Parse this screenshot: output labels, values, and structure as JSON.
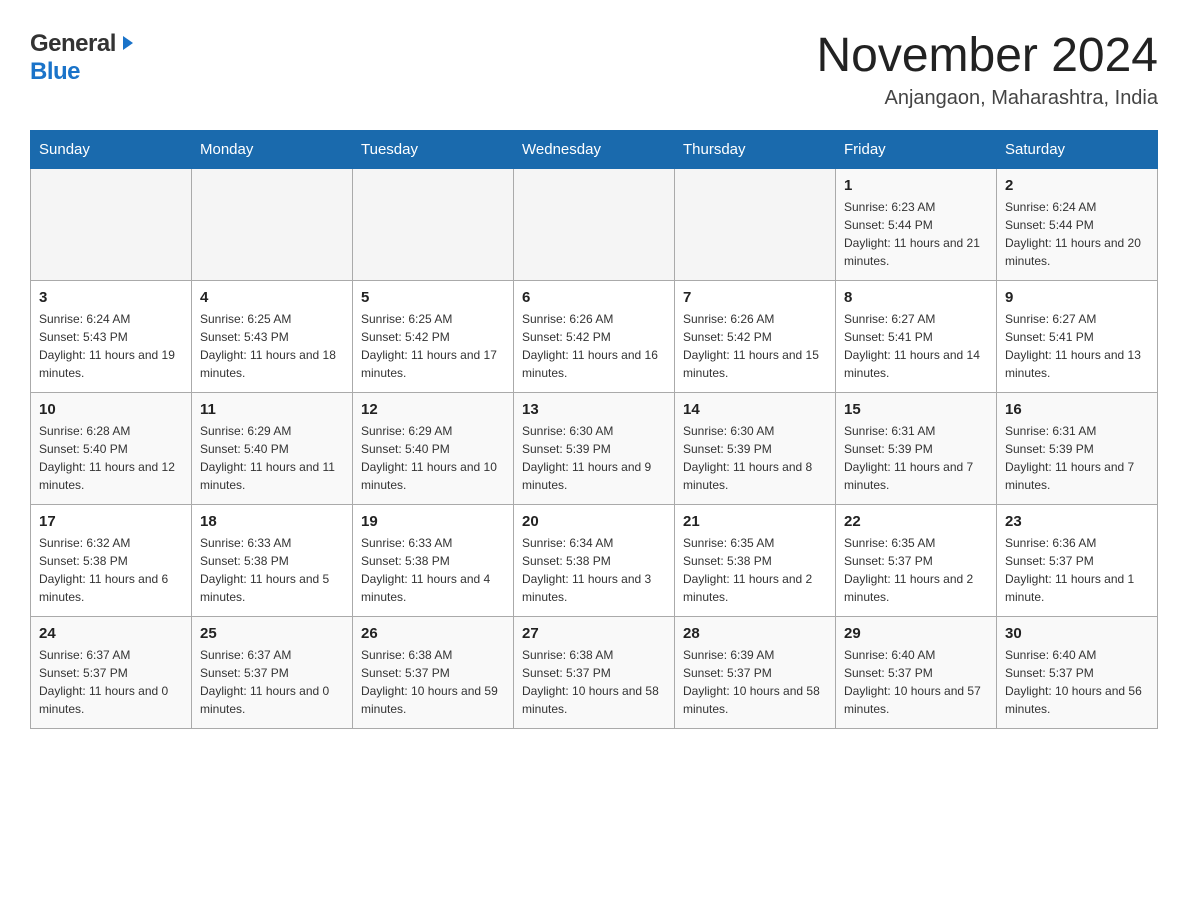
{
  "header": {
    "logo_general": "General",
    "logo_blue": "Blue",
    "month_title": "November 2024",
    "location": "Anjangaon, Maharashtra, India"
  },
  "weekdays": [
    "Sunday",
    "Monday",
    "Tuesday",
    "Wednesday",
    "Thursday",
    "Friday",
    "Saturday"
  ],
  "weeks": [
    [
      {
        "day": "",
        "info": ""
      },
      {
        "day": "",
        "info": ""
      },
      {
        "day": "",
        "info": ""
      },
      {
        "day": "",
        "info": ""
      },
      {
        "day": "",
        "info": ""
      },
      {
        "day": "1",
        "info": "Sunrise: 6:23 AM\nSunset: 5:44 PM\nDaylight: 11 hours and 21 minutes."
      },
      {
        "day": "2",
        "info": "Sunrise: 6:24 AM\nSunset: 5:44 PM\nDaylight: 11 hours and 20 minutes."
      }
    ],
    [
      {
        "day": "3",
        "info": "Sunrise: 6:24 AM\nSunset: 5:43 PM\nDaylight: 11 hours and 19 minutes."
      },
      {
        "day": "4",
        "info": "Sunrise: 6:25 AM\nSunset: 5:43 PM\nDaylight: 11 hours and 18 minutes."
      },
      {
        "day": "5",
        "info": "Sunrise: 6:25 AM\nSunset: 5:42 PM\nDaylight: 11 hours and 17 minutes."
      },
      {
        "day": "6",
        "info": "Sunrise: 6:26 AM\nSunset: 5:42 PM\nDaylight: 11 hours and 16 minutes."
      },
      {
        "day": "7",
        "info": "Sunrise: 6:26 AM\nSunset: 5:42 PM\nDaylight: 11 hours and 15 minutes."
      },
      {
        "day": "8",
        "info": "Sunrise: 6:27 AM\nSunset: 5:41 PM\nDaylight: 11 hours and 14 minutes."
      },
      {
        "day": "9",
        "info": "Sunrise: 6:27 AM\nSunset: 5:41 PM\nDaylight: 11 hours and 13 minutes."
      }
    ],
    [
      {
        "day": "10",
        "info": "Sunrise: 6:28 AM\nSunset: 5:40 PM\nDaylight: 11 hours and 12 minutes."
      },
      {
        "day": "11",
        "info": "Sunrise: 6:29 AM\nSunset: 5:40 PM\nDaylight: 11 hours and 11 minutes."
      },
      {
        "day": "12",
        "info": "Sunrise: 6:29 AM\nSunset: 5:40 PM\nDaylight: 11 hours and 10 minutes."
      },
      {
        "day": "13",
        "info": "Sunrise: 6:30 AM\nSunset: 5:39 PM\nDaylight: 11 hours and 9 minutes."
      },
      {
        "day": "14",
        "info": "Sunrise: 6:30 AM\nSunset: 5:39 PM\nDaylight: 11 hours and 8 minutes."
      },
      {
        "day": "15",
        "info": "Sunrise: 6:31 AM\nSunset: 5:39 PM\nDaylight: 11 hours and 7 minutes."
      },
      {
        "day": "16",
        "info": "Sunrise: 6:31 AM\nSunset: 5:39 PM\nDaylight: 11 hours and 7 minutes."
      }
    ],
    [
      {
        "day": "17",
        "info": "Sunrise: 6:32 AM\nSunset: 5:38 PM\nDaylight: 11 hours and 6 minutes."
      },
      {
        "day": "18",
        "info": "Sunrise: 6:33 AM\nSunset: 5:38 PM\nDaylight: 11 hours and 5 minutes."
      },
      {
        "day": "19",
        "info": "Sunrise: 6:33 AM\nSunset: 5:38 PM\nDaylight: 11 hours and 4 minutes."
      },
      {
        "day": "20",
        "info": "Sunrise: 6:34 AM\nSunset: 5:38 PM\nDaylight: 11 hours and 3 minutes."
      },
      {
        "day": "21",
        "info": "Sunrise: 6:35 AM\nSunset: 5:38 PM\nDaylight: 11 hours and 2 minutes."
      },
      {
        "day": "22",
        "info": "Sunrise: 6:35 AM\nSunset: 5:37 PM\nDaylight: 11 hours and 2 minutes."
      },
      {
        "day": "23",
        "info": "Sunrise: 6:36 AM\nSunset: 5:37 PM\nDaylight: 11 hours and 1 minute."
      }
    ],
    [
      {
        "day": "24",
        "info": "Sunrise: 6:37 AM\nSunset: 5:37 PM\nDaylight: 11 hours and 0 minutes."
      },
      {
        "day": "25",
        "info": "Sunrise: 6:37 AM\nSunset: 5:37 PM\nDaylight: 11 hours and 0 minutes."
      },
      {
        "day": "26",
        "info": "Sunrise: 6:38 AM\nSunset: 5:37 PM\nDaylight: 10 hours and 59 minutes."
      },
      {
        "day": "27",
        "info": "Sunrise: 6:38 AM\nSunset: 5:37 PM\nDaylight: 10 hours and 58 minutes."
      },
      {
        "day": "28",
        "info": "Sunrise: 6:39 AM\nSunset: 5:37 PM\nDaylight: 10 hours and 58 minutes."
      },
      {
        "day": "29",
        "info": "Sunrise: 6:40 AM\nSunset: 5:37 PM\nDaylight: 10 hours and 57 minutes."
      },
      {
        "day": "30",
        "info": "Sunrise: 6:40 AM\nSunset: 5:37 PM\nDaylight: 10 hours and 56 minutes."
      }
    ]
  ]
}
